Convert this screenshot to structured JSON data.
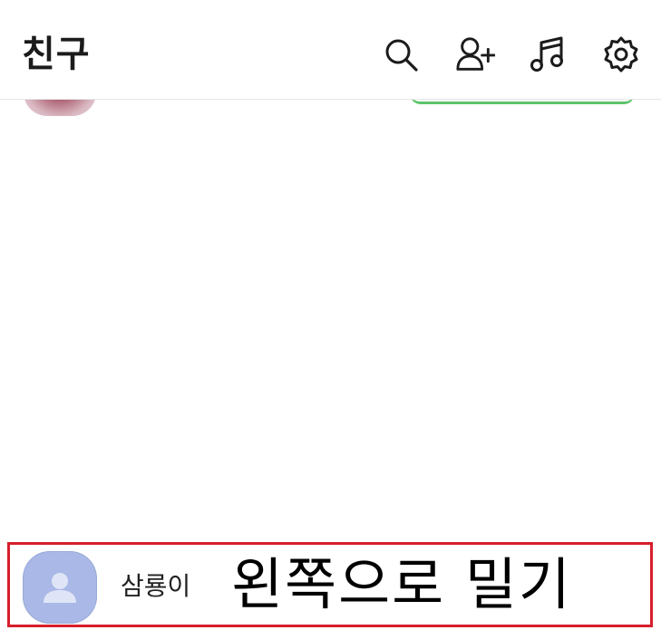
{
  "header": {
    "title": "친구",
    "icons": [
      "search-icon",
      "add-friend-icon",
      "music-icon",
      "settings-icon"
    ]
  },
  "friend_row": {
    "name": "삼룡이",
    "hint": "왼쪽으로 밀기",
    "highlight_color": "#d61f2c",
    "avatar_color": "#a9b8e6"
  }
}
